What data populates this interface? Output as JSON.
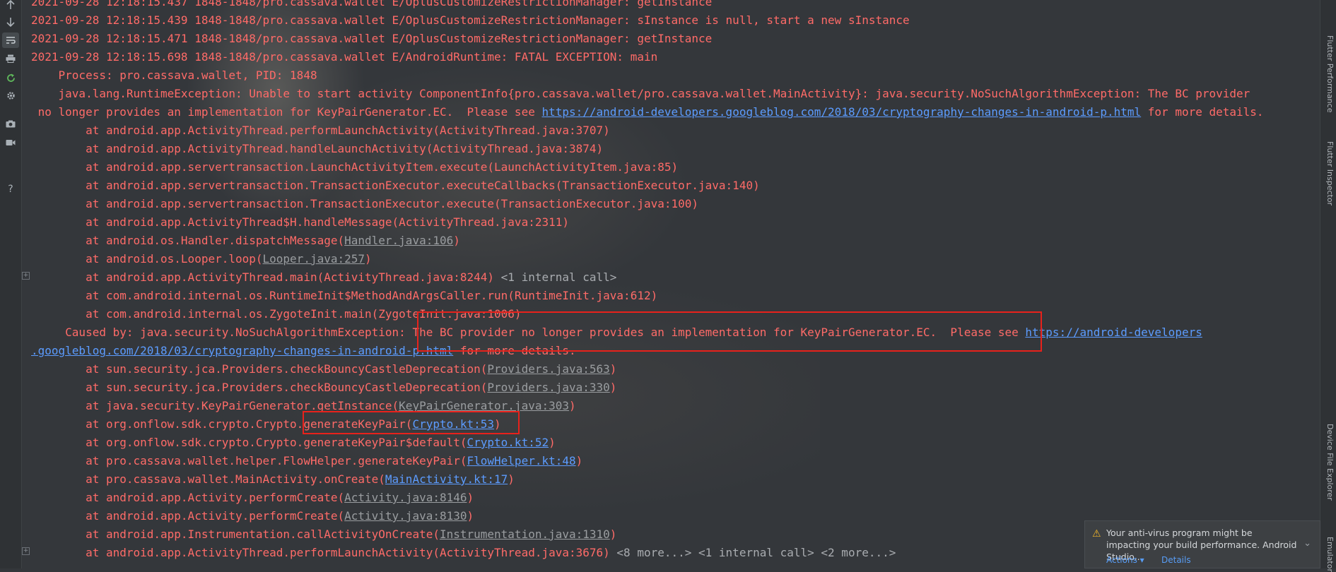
{
  "toolbar": {
    "icons": [
      "arrow-up-icon",
      "arrow-down-icon",
      "soft-wrap-icon",
      "print-icon",
      "restart-icon",
      "settings-icon",
      "camera-icon",
      "video-icon",
      "help-icon"
    ],
    "help_label": "?"
  },
  "right_tabs": {
    "flutter_performance": "Flutter Performance",
    "flutter_inspector": "Flutter Inspector",
    "device_file_explorer": "Device File Explorer",
    "emulator": "Emulator"
  },
  "log": {
    "l0": "2021-09-28 12:18:15.437 1848-1848/pro.cassava.wallet E/OplusCustomizeRestrictionManager: getInstance",
    "l1": "2021-09-28 12:18:15.439 1848-1848/pro.cassava.wallet E/OplusCustomizeRestrictionManager: sInstance is null, start a new sInstance",
    "l2": "2021-09-28 12:18:15.471 1848-1848/pro.cassava.wallet E/OplusCustomizeRestrictionManager: getInstance",
    "l3": "2021-09-28 12:18:15.698 1848-1848/pro.cassava.wallet E/AndroidRuntime: FATAL EXCEPTION: main",
    "l4": "    Process: pro.cassava.wallet, PID: 1848",
    "l5": "    java.lang.RuntimeException: Unable to start activity ComponentInfo{pro.cassava.wallet/pro.cassava.wallet.MainActivity}: java.security.NoSuchAlgorithmException: The BC provider",
    "l6a": " no longer provides an implementation for KeyPairGenerator.EC.  Please see ",
    "l6link": "https://android-developers.googleblog.com/2018/03/cryptography-changes-in-android-p.html",
    "l6b": " for more details.",
    "l7": "        at android.app.ActivityThread.performLaunchActivity(ActivityThread.java:3707)",
    "l8": "        at android.app.ActivityThread.handleLaunchActivity(ActivityThread.java:3874)",
    "l9": "        at android.app.servertransaction.LaunchActivityItem.execute(LaunchActivityItem.java:85)",
    "l10": "        at android.app.servertransaction.TransactionExecutor.executeCallbacks(TransactionExecutor.java:140)",
    "l11": "        at android.app.servertransaction.TransactionExecutor.execute(TransactionExecutor.java:100)",
    "l12": "        at android.app.ActivityThread$H.handleMessage(ActivityThread.java:2311)",
    "l13a": "        at android.os.Handler.dispatchMessage(",
    "l13link": "Handler.java:106",
    "l13b": ")",
    "l14a": "        at android.os.Looper.loop(",
    "l14link": "Looper.java:257",
    "l14b": ")",
    "l15a": "        at android.app.ActivityThread.main(ActivityThread.java:8244) ",
    "l15meta": "<1 internal call>",
    "l16": "        at com.android.internal.os.RuntimeInit$MethodAndArgsCaller.run(RuntimeInit.java:612)",
    "l17": "        at com.android.internal.os.ZygoteInit.main(ZygoteInit.java:1006)",
    "l18a": "     Caused by: java.security.NoSuchAlgorithmException: The BC provider no longer provides an implementation for KeyPairGenerator.EC.  Please see ",
    "l18link": "https://android-developers",
    "l19link": ".googleblog.com/2018/03/cryptography-changes-in-android-p.html",
    "l19b": " for more details.",
    "l20a": "        at sun.security.jca.Providers.checkBouncyCastleDeprecation(",
    "l20link": "Providers.java:563",
    "l20b": ")",
    "l21a": "        at sun.security.jca.Providers.checkBouncyCastleDeprecation(",
    "l21link": "Providers.java:330",
    "l21b": ")",
    "l22a": "        at java.security.KeyPairGenerator.getInstance(",
    "l22link": "KeyPairGenerator.java:303",
    "l22b": ")",
    "l23a": "        at org.onflow.sdk.crypto.Crypto.generateKeyPair(",
    "l23link": "Crypto.kt:53",
    "l23b": ")",
    "l24a": "        at org.onflow.sdk.crypto.Crypto.generateKeyPair$default(",
    "l24link": "Crypto.kt:52",
    "l24b": ")",
    "l25a": "        at pro.cassava.wallet.helper.FlowHelper.generateKeyPair(",
    "l25link": "FlowHelper.kt:48",
    "l25b": ")",
    "l26a": "        at pro.cassava.wallet.MainActivity.onCreate(",
    "l26link": "MainActivity.kt:17",
    "l26b": ")",
    "l27a": "        at android.app.Activity.performCreate(",
    "l27link": "Activity.java:8146",
    "l27b": ")",
    "l28a": "        at android.app.Activity.performCreate(",
    "l28link": "Activity.java:8130",
    "l28b": ")",
    "l29a": "        at android.app.Instrumentation.callActivityOnCreate(",
    "l29link": "Instrumentation.java:1310",
    "l29b": ")",
    "l30a": "        at android.app.ActivityThread.performLaunchActivity(ActivityThread.java:3676) ",
    "l30meta": "<8 more...> <1 internal call> <2 more...>"
  },
  "notification": {
    "message": "Your anti-virus program might be impacting your build performance. Android Studio...",
    "actions_label": "Actions ▾",
    "details_label": "Details"
  },
  "colors": {
    "error_text": "#ff6b68",
    "link": "#5c9cff",
    "highlight_box": "#e8211b",
    "background": "#34373b"
  }
}
